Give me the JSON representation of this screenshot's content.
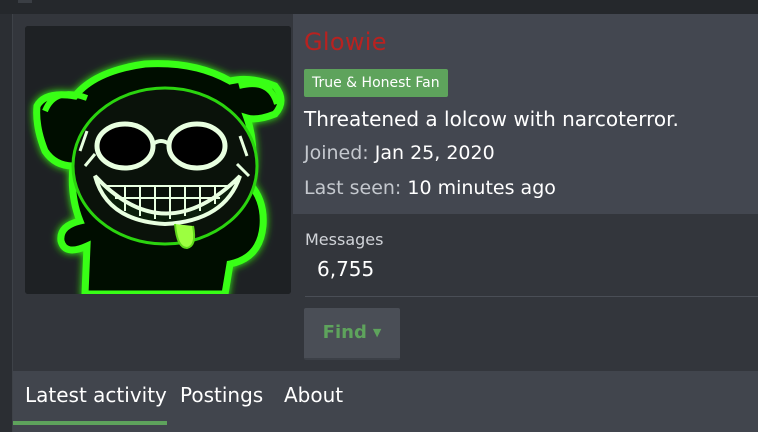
{
  "profile": {
    "username": "Glowie",
    "badge": "True & Honest Fan",
    "tagline": "Threatened a lolcow with narcoterror.",
    "joined_label": "Joined:",
    "joined_value": "Jan 25, 2020",
    "seen_label": "Last seen:",
    "seen_value": "10 minutes ago",
    "username_color": "#b82220",
    "badge_color": "#5ea35c"
  },
  "stats": {
    "messages_label": "Messages",
    "messages_value": "6,755"
  },
  "actions": {
    "find_label": "Find"
  },
  "tabs": [
    {
      "label": "Latest activity",
      "active": true
    },
    {
      "label": "Postings",
      "active": false
    },
    {
      "label": "About",
      "active": false
    }
  ],
  "colors": {
    "accent": "#5ea35c",
    "avatar_glow": "#39ff14"
  }
}
